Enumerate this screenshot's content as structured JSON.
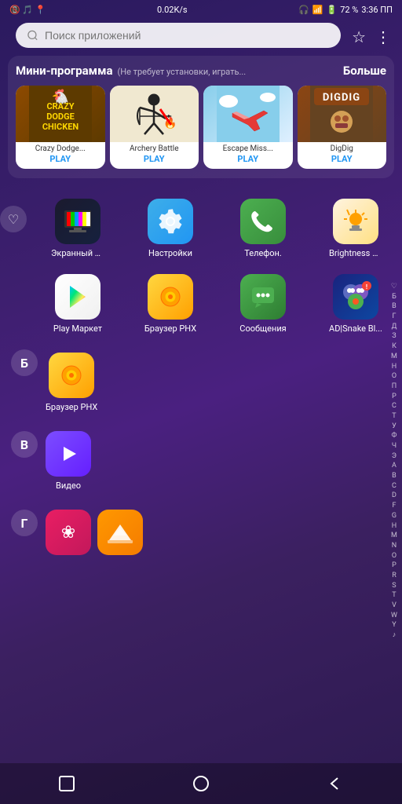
{
  "statusBar": {
    "network": "0.02K/s",
    "battery": "72 %",
    "time": "3:36 ПП"
  },
  "search": {
    "placeholder": "Поиск приложений"
  },
  "miniSection": {
    "title": "Мини-программа",
    "subtitle": "(Не требует установки, играть...",
    "more": "Больше",
    "apps": [
      {
        "name": "Crazy Dodge...",
        "play": "PLAY",
        "bg": "mini-crazy",
        "emoji": "🐔"
      },
      {
        "name": "Archery Battle",
        "play": "PLAY",
        "bg": "mini-archery",
        "emoji": "🏹"
      },
      {
        "name": "Escape Miss...",
        "play": "PLAY",
        "bg": "mini-escape",
        "emoji": "✈️"
      },
      {
        "name": "DigDig",
        "play": "PLAY",
        "bg": "mini-digdig",
        "emoji": "⛏️"
      }
    ]
  },
  "appRows": [
    {
      "sectionIcon": "♡",
      "apps": [
        {
          "name": "Экранный Т...",
          "icon": "📺",
          "bg": "bg-tv",
          "type": "tv"
        },
        {
          "name": "Настройки",
          "icon": "⚙️",
          "bg": "bg-settings",
          "type": "settings"
        },
        {
          "name": "Телефон.",
          "icon": "📞",
          "bg": "bg-phone",
          "type": "phone"
        },
        {
          "name": "Brightness C...",
          "icon": "💡",
          "bg": "bg-brightness",
          "type": "brightness"
        }
      ]
    },
    {
      "apps": [
        {
          "name": "Play Маркет",
          "icon": "▶",
          "bg": "bg-playmarket",
          "type": "playmarket"
        },
        {
          "name": "Браузер PHX",
          "icon": "⊙",
          "bg": "bg-browser",
          "type": "browser-yellow"
        },
        {
          "name": "Сообщения",
          "icon": "💬",
          "bg": "bg-messages",
          "type": "messages"
        },
        {
          "name": "AD|Snake Bl...",
          "icon": "🎮",
          "bg": "bg-snake",
          "type": "snake"
        }
      ]
    }
  ],
  "sectionB": {
    "letter": "Б",
    "apps": [
      {
        "name": "Браузер PHX",
        "icon": "⊙",
        "bg": "bg-browser",
        "type": "browser-yellow"
      }
    ]
  },
  "sectionV": {
    "letter": "В",
    "apps": [
      {
        "name": "Видео",
        "icon": "▶",
        "bg": "bg-video",
        "type": "video"
      }
    ]
  },
  "sectionG": {
    "letter": "Г",
    "apps": [
      {
        "name": "",
        "icon": "❀",
        "bg": "bg-pink",
        "type": "pink"
      },
      {
        "name": "",
        "icon": "🏔",
        "bg": "bg-orange",
        "type": "orange"
      }
    ]
  },
  "alphaSidebar": [
    "♡",
    "Б",
    "В",
    "Г",
    "Д",
    "З",
    "К",
    "М",
    "Н",
    "О",
    "П",
    "Р",
    "С",
    "Т",
    "У",
    "Ф",
    "Ч",
    "Э",
    "А",
    "B",
    "C",
    "D",
    "F",
    "G",
    "H",
    "M",
    "N",
    "O",
    "P",
    "R",
    "S",
    "T",
    "V",
    "W",
    "Y",
    "♪"
  ],
  "bottomNav": {
    "square": "□",
    "circle": "○",
    "back": "◁"
  }
}
